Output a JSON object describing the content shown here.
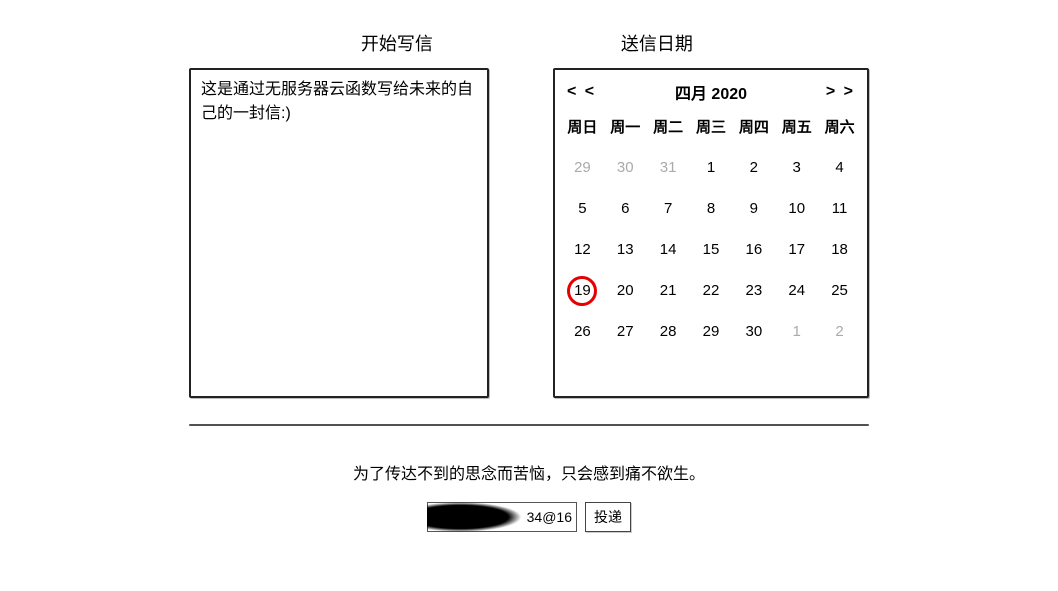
{
  "headers": {
    "left": "开始写信",
    "right": "送信日期"
  },
  "letter": {
    "content": "这是通过无服务器云函数写给未来的自己的一封信:)"
  },
  "calendar": {
    "prev": "< <",
    "next": "> >",
    "title": "四月 2020",
    "weekdays": [
      "周日",
      "周一",
      "周二",
      "周三",
      "周四",
      "周五",
      "周六"
    ],
    "days": [
      {
        "d": "29",
        "muted": true
      },
      {
        "d": "30",
        "muted": true
      },
      {
        "d": "31",
        "muted": true
      },
      {
        "d": "1"
      },
      {
        "d": "2"
      },
      {
        "d": "3"
      },
      {
        "d": "4"
      },
      {
        "d": "5"
      },
      {
        "d": "6"
      },
      {
        "d": "7"
      },
      {
        "d": "8"
      },
      {
        "d": "9"
      },
      {
        "d": "10"
      },
      {
        "d": "11"
      },
      {
        "d": "12"
      },
      {
        "d": "13"
      },
      {
        "d": "14"
      },
      {
        "d": "15"
      },
      {
        "d": "16"
      },
      {
        "d": "17"
      },
      {
        "d": "18"
      },
      {
        "d": "19",
        "today": true
      },
      {
        "d": "20"
      },
      {
        "d": "21"
      },
      {
        "d": "22"
      },
      {
        "d": "23"
      },
      {
        "d": "24"
      },
      {
        "d": "25"
      },
      {
        "d": "26"
      },
      {
        "d": "27"
      },
      {
        "d": "28"
      },
      {
        "d": "29"
      },
      {
        "d": "30"
      },
      {
        "d": "1",
        "muted": true
      },
      {
        "d": "2",
        "muted": true
      }
    ]
  },
  "quote": "为了传达不到的思念而苦恼，只会感到痛不欲生。",
  "email": {
    "value": "34@16"
  },
  "send_label": "投递"
}
